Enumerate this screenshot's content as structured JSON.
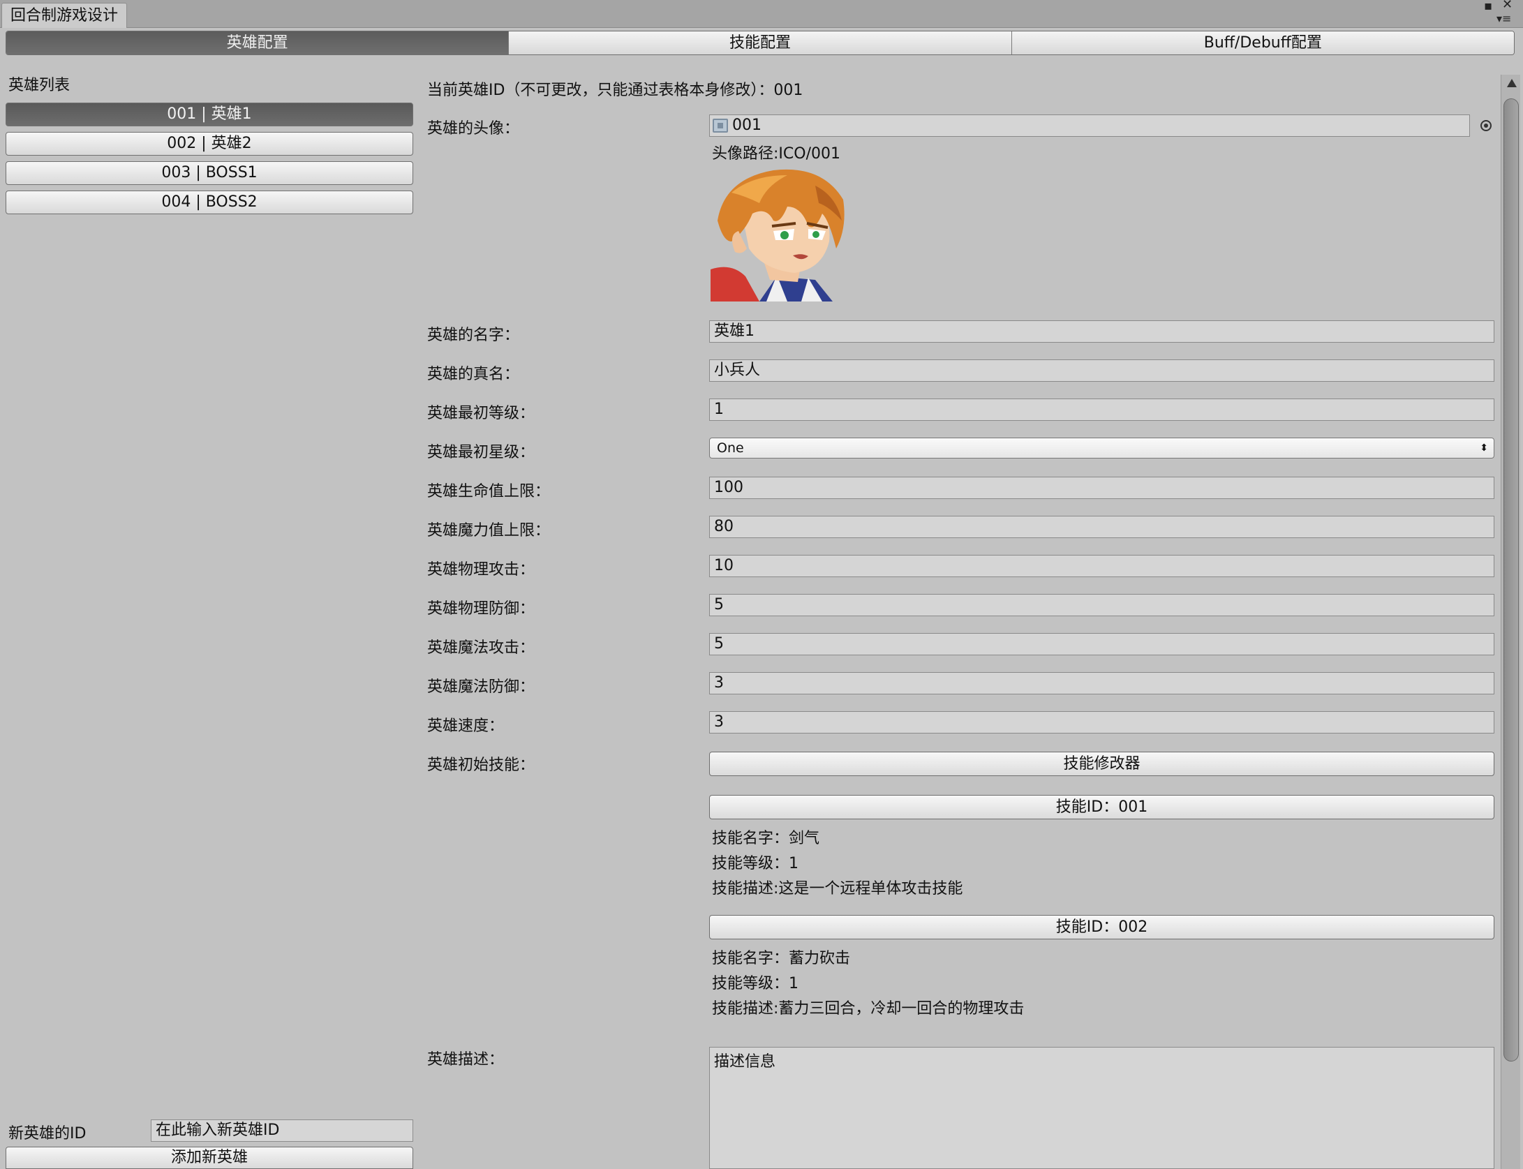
{
  "window": {
    "tab_title": "回合制游戏设计"
  },
  "toolbar": {
    "tabs": [
      "英雄配置",
      "技能配置",
      "Buff/Debuff配置"
    ]
  },
  "sidebar": {
    "title": "英雄列表",
    "heroes": [
      "001 | 英雄1",
      "002 | 英雄2",
      "003 | BOSS1",
      "004 | BOSS2"
    ],
    "new_id_label": "新英雄的ID",
    "new_id_value": "在此输入新英雄ID",
    "add_button": "添加新英雄"
  },
  "form": {
    "current_id": "当前英雄ID（不可更改，只能通过表格本身修改）：001",
    "avatar_label": "英雄的头像：",
    "avatar_value": "001",
    "avatar_path": "头像路径:ICO/001",
    "name_label": "英雄的名字：",
    "name_value": "英雄1",
    "true_name_label": "英雄的真名：",
    "true_name_value": "小兵人",
    "level_label": "英雄最初等级：",
    "level_value": "1",
    "star_label": "英雄最初星级：",
    "star_value": "One",
    "hp_label": "英雄生命值上限：",
    "hp_value": "100",
    "mp_label": "英雄魔力值上限：",
    "mp_value": "80",
    "patk_label": "英雄物理攻击：",
    "patk_value": "10",
    "pdef_label": "英雄物理防御：",
    "pdef_value": "5",
    "matk_label": "英雄魔法攻击：",
    "matk_value": "5",
    "mdef_label": "英雄魔法防御：",
    "mdef_value": "3",
    "speed_label": "英雄速度：",
    "speed_value": "3",
    "skills_label": "英雄初始技能：",
    "skill_editor_button": "技能修改器",
    "skills": [
      {
        "id_button": "技能ID：001",
        "name": "技能名字：剑气",
        "level": "技能等级：1",
        "desc": "技能描述:这是一个远程单体攻击技能"
      },
      {
        "id_button": "技能ID：002",
        "name": "技能名字：蓄力砍击",
        "level": "技能等级：1",
        "desc": "技能描述:蓄力三回合，冷却一回合的物理攻击"
      }
    ],
    "desc_label": "英雄描述：",
    "desc_value": "描述信息"
  }
}
